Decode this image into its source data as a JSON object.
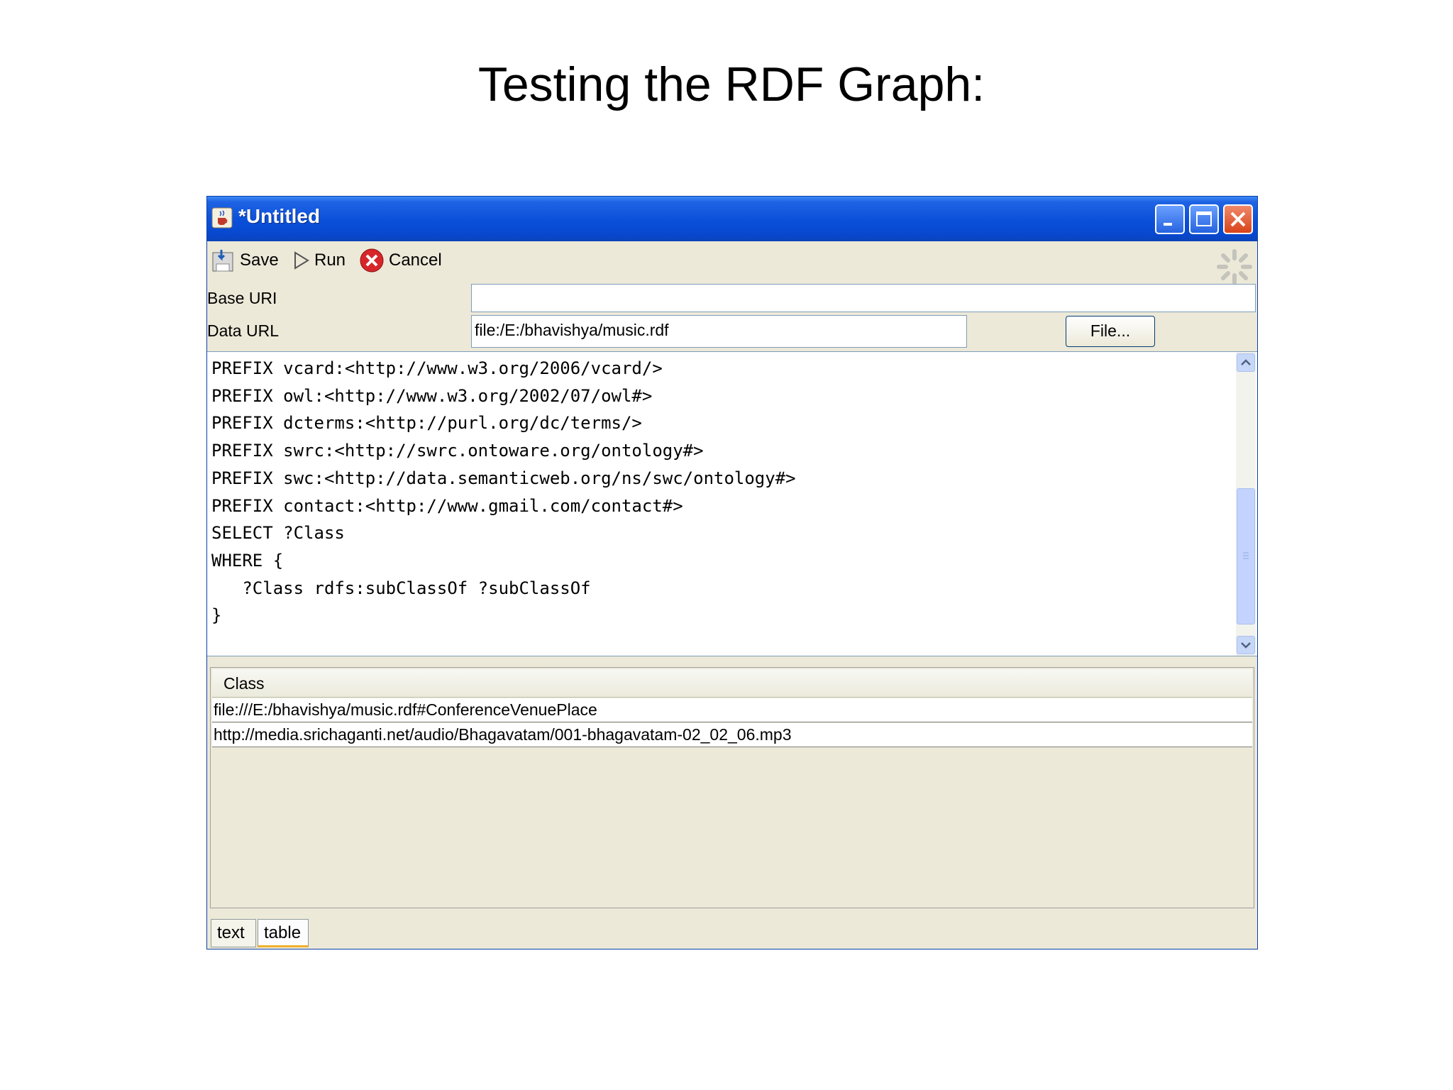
{
  "slide": {
    "title": "Testing the RDF Graph:"
  },
  "window": {
    "title": "*Untitled",
    "title_bar_color": "#0a4fd9",
    "icons": {
      "app": "java-cup-icon",
      "minimize": "minimize-icon",
      "maximize": "maximize-icon",
      "close": "close-icon"
    }
  },
  "toolbar": {
    "save_label": "Save",
    "run_label": "Run",
    "cancel_label": "Cancel",
    "icons": {
      "save": "save-icon",
      "run": "play-icon",
      "cancel": "cancel-icon",
      "busy": "busy-spinner-icon"
    }
  },
  "form": {
    "base_uri_label": "Base URI",
    "base_uri_value": "",
    "data_url_label": "Data URL",
    "data_url_value": "file:/E:/bhavishya/music.rdf",
    "file_button_label": "File..."
  },
  "query": {
    "text": "PREFIX vcard:<http://www.w3.org/2006/vcard/>\nPREFIX owl:<http://www.w3.org/2002/07/owl#>\nPREFIX dcterms:<http://purl.org/dc/terms/>\nPREFIX swrc:<http://swrc.ontoware.org/ontology#>\nPREFIX swc:<http://data.semanticweb.org/ns/swc/ontology#>\nPREFIX contact:<http://www.gmail.com/contact#>\nSELECT ?Class\nWHERE {\n   ?Class rdfs:subClassOf ?subClassOf\n}"
  },
  "results": {
    "column_header": "Class",
    "rows": [
      "file:///E:/bhavishya/music.rdf#ConferenceVenuePlace",
      "http://media.srichaganti.net/audio/Bhagavatam/001-bhagavatam-02_02_06.mp3"
    ]
  },
  "tabs": [
    {
      "label": "text",
      "selected": false
    },
    {
      "label": "table",
      "selected": true
    }
  ]
}
